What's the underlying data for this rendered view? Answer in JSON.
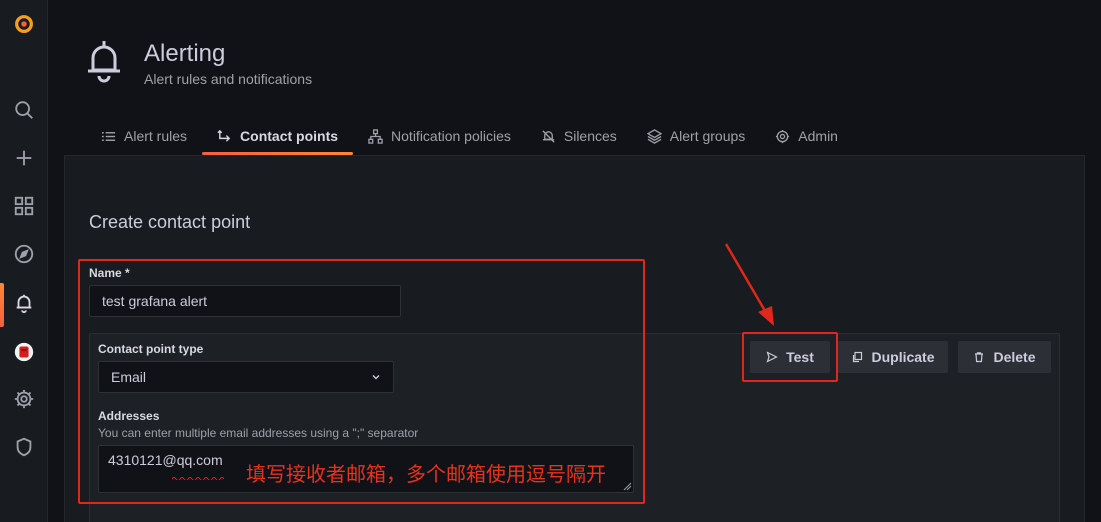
{
  "sidebar": {
    "items": [
      {
        "name": "grafana-logo-icon"
      },
      {
        "name": "search-icon"
      },
      {
        "name": "plus-icon"
      },
      {
        "name": "dashboards-icon"
      },
      {
        "name": "explore-icon"
      },
      {
        "name": "alerting-bell-icon"
      },
      {
        "name": "user-avatar"
      },
      {
        "name": "gear-icon"
      },
      {
        "name": "shield-icon"
      }
    ],
    "active_item": "alerting-bell-icon",
    "accent_color": "#f55f3e"
  },
  "header": {
    "title": "Alerting",
    "subtitle": "Alert rules and notifications"
  },
  "tabs": [
    {
      "label": "Alert rules",
      "icon": "list-icon",
      "active": false
    },
    {
      "label": "Contact points",
      "icon": "comment-arrow-icon",
      "active": true
    },
    {
      "label": "Notification policies",
      "icon": "sitemap-icon",
      "active": false
    },
    {
      "label": "Silences",
      "icon": "bell-slash-icon",
      "active": false
    },
    {
      "label": "Alert groups",
      "icon": "layer-group-icon",
      "active": false
    },
    {
      "label": "Admin",
      "icon": "cog-icon",
      "active": false
    }
  ],
  "form": {
    "section_title": "Create contact point",
    "name_label": "Name *",
    "name_value": "test grafana alert",
    "type_label": "Contact point type",
    "type_value": "Email",
    "addresses_label": "Addresses",
    "addresses_desc": "You can enter multiple email addresses using a \";\" separator",
    "addresses_value": "4310121@qq.com"
  },
  "actions": {
    "test_label": "Test",
    "duplicate_label": "Duplicate",
    "delete_label": "Delete"
  },
  "annotation": {
    "text": "填写接收者邮箱，多个邮箱使用逗号隔开",
    "color": "#e0271b"
  }
}
